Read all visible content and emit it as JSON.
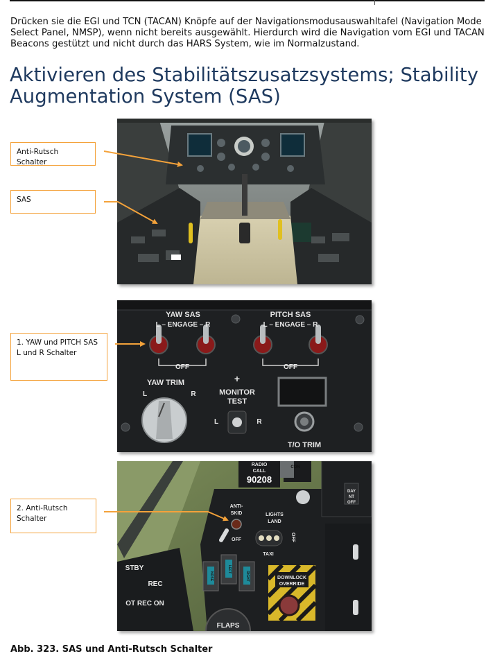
{
  "intro_text": "Drücken sie die EGI und TCN (TACAN) Knöpfe auf der Navigationsmodusauswahltafel (Navigation Mode Select Panel, NMSP), wenn nicht bereits ausgewählt. Hierdurch wird die Navigation vom EGI und TACAN Beacons gestützt und nicht durch das HARS System, wie im Normalzustand.",
  "heading": "Aktivieren des Stabilitätszusatzsystems; Stability Augmentation System (SAS)",
  "callouts": {
    "anti_skid": "Anti-Rutsch Schalter",
    "sas": "SAS",
    "yaw_pitch": "1. YAW und PITCH SAS L und R Schalter",
    "anti_skid_2": "2. Anti-Rutsch Schalter"
  },
  "sas_panel": {
    "yaw_sas": "YAW SAS",
    "yaw_engage": "L – ENGAGE – R",
    "pitch_sas": "PITCH SAS",
    "pitch_engage": "L – ENGAGE – R",
    "off_left": "OFF",
    "off_right": "OFF",
    "yaw_trim": "YAW TRIM",
    "trim_l": "L",
    "trim_r": "R",
    "plus": "+",
    "monitor": "MONITOR",
    "test": "TEST",
    "test_l": "L",
    "test_r": "R",
    "to_trim": "T/O TRIM"
  },
  "gear_panel": {
    "radio": "RADIO",
    "call": "CALL",
    "tail_number": "90208",
    "anti": "ANTI-",
    "skid": "SKID",
    "off": "OFF",
    "lights": "LIGHTS",
    "land": "LAND",
    "taxi": "TAXI",
    "lights_off": "OFF",
    "downlock": "DOWNLOCK",
    "override": "OVERRIDE",
    "stby": "STBY",
    "rec": "REC",
    "ot_rec_on": "OT  REC  ON",
    "flaps": "FLAPS",
    "day": "DAY",
    "nt": "NT",
    "day_off": "OFF",
    "con": "CON",
    "land_gear_1": "NOSE",
    "land_gear_2": "LEFT",
    "land_gear_3": "RIGHT"
  },
  "caption": "Abb. 323. SAS und Anti-Rutsch Schalter"
}
